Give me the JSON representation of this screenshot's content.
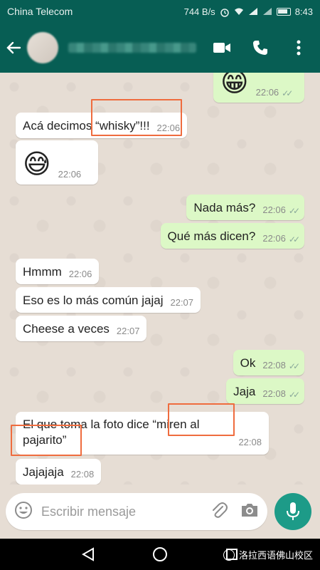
{
  "status_bar": {
    "carrier": "China Telecom",
    "speed": "744 B/s",
    "time": "8:43"
  },
  "app_bar": {
    "icons": [
      "back-arrow-icon",
      "video-call-icon",
      "phone-icon",
      "more-vert-icon"
    ]
  },
  "messages": [
    {
      "dir": "out",
      "emoji": "😁",
      "time": "22:06"
    },
    {
      "dir": "in",
      "text": "Acá decimos “whisky”!!!",
      "time": "22:06"
    },
    {
      "dir": "in",
      "emoji": "😅",
      "time": "22:06"
    },
    {
      "dir": "out",
      "text": "Nada más?",
      "time": "22:06"
    },
    {
      "dir": "out",
      "text": "Qué más dicen?",
      "time": "22:06"
    },
    {
      "dir": "in",
      "text": "Hmmm",
      "time": "22:06"
    },
    {
      "dir": "in",
      "text": "Eso es lo más común jajaj",
      "time": "22:07"
    },
    {
      "dir": "in",
      "text": "Cheese a veces",
      "time": "22:07"
    },
    {
      "dir": "out",
      "text": "Ok",
      "time": "22:08"
    },
    {
      "dir": "out",
      "text": "Jaja",
      "time": "22:08"
    },
    {
      "dir": "in",
      "line1": "El que toma la foto dice “miren al",
      "line2": "pajarito”",
      "time": "22:08"
    },
    {
      "dir": "in",
      "text": "Jajajaja",
      "time": "22:08"
    }
  ],
  "composer": {
    "placeholder": "Escribir mensaje"
  },
  "watermark": "洛拉西语佛山校区",
  "colors": {
    "header": "#075e54",
    "outgoing_bubble": "#dcf8c6",
    "incoming_bubble": "#ffffff",
    "highlight": "#ef6c3e",
    "mic_button": "#1d9b88"
  }
}
